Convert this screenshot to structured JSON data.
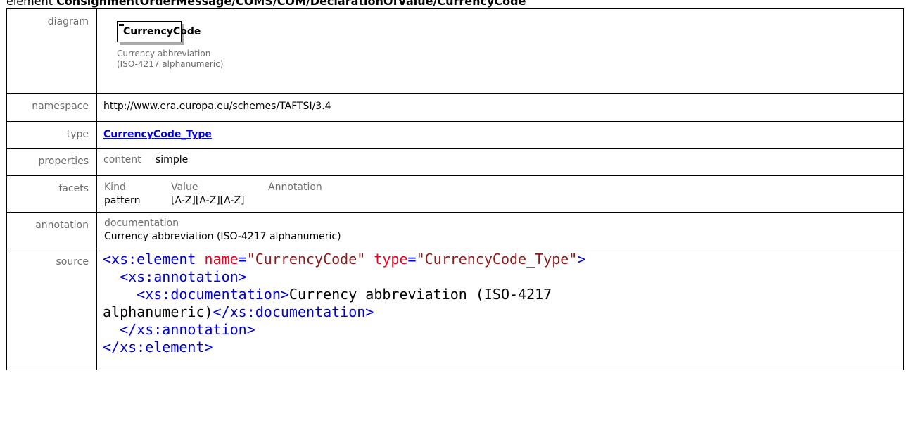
{
  "header": {
    "prefix": "element ",
    "path": "ConsignmentOrderMessage/COMS/COM/DeclarationOfValue/CurrencyCode"
  },
  "rows": {
    "diagram": {
      "label": "diagram",
      "element_name": "CurrencyCode",
      "doc_line1": "Currency abbreviation",
      "doc_line2": "(ISO-4217 alphanumeric)"
    },
    "namespace": {
      "label": "namespace",
      "value": "http://www.era.europa.eu/schemes/TAFTSI/3.4"
    },
    "type": {
      "label": "type",
      "value": "CurrencyCode_Type"
    },
    "properties": {
      "label": "properties",
      "key": "content",
      "value": "simple"
    },
    "facets": {
      "label": "facets",
      "col_kind": "Kind",
      "col_value": "Value",
      "col_annotation": "Annotation",
      "kind": "pattern",
      "value": "[A-Z][A-Z][A-Z]",
      "annotation": ""
    },
    "annotation": {
      "label": "annotation",
      "key": "documentation",
      "text": "Currency abbreviation (ISO-4217 alphanumeric)"
    },
    "source": {
      "label": "source",
      "l1_open": "<xs:element",
      "l1_attr1": "name",
      "l1_eq1": "=",
      "l1_val1": "\"CurrencyCode\"",
      "l1_attr2": "type",
      "l1_eq2": "=",
      "l1_val2": "\"CurrencyCode_Type\"",
      "l1_close": ">",
      "l2": "<xs:annotation>",
      "l3_open": "<xs:documentation>",
      "l3_text": "Currency abbreviation (ISO-4217",
      "l4_text": "alphanumeric)",
      "l4_close": "</xs:documentation>",
      "l5": "</xs:annotation>",
      "l6": "</xs:element>"
    }
  }
}
